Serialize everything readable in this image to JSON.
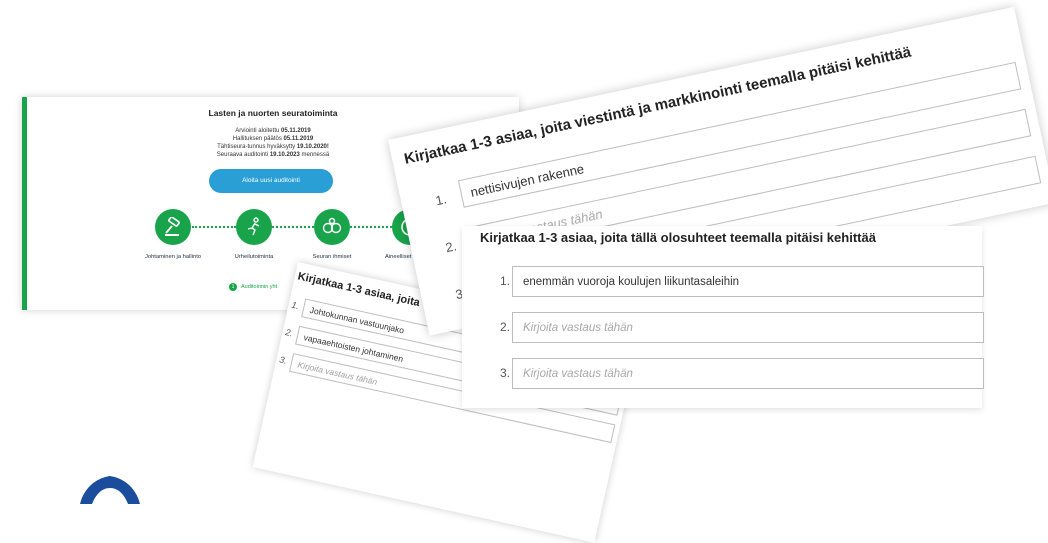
{
  "audit": {
    "title": "Lasten ja nuorten seuratoiminta",
    "lines": [
      {
        "label": "Arviointi aloitettu",
        "value": "05.11.2019"
      },
      {
        "label": "Hallituksen päätös",
        "value": "05.11.2019"
      },
      {
        "label": "Tähtiseura-tunnus hyväksytty",
        "value": "19.10.2020!"
      },
      {
        "label": "Seuraava auditointi",
        "value": "19.10.2023",
        "suffix": "mennessä"
      }
    ],
    "start_button": "Aloita uusi auditointi",
    "steps": [
      {
        "label": "Johtaminen ja hallinto",
        "icon": "gavel-icon"
      },
      {
        "label": "Urheilutoiminta",
        "icon": "runner-icon"
      },
      {
        "label": "Seuran ihmiset",
        "icon": "people-icon"
      },
      {
        "label": "Aineelliset resurssit",
        "icon": "resources-icon"
      }
    ],
    "progress_number": "1",
    "progress_text": "Auditoinnin yht"
  },
  "marketing": {
    "title": "Kirjatkaa 1-3 asiaa, joita viestintä ja markkinointi teemalla pitäisi kehittää",
    "rows": [
      {
        "num": "1.",
        "value": "nettisivujen rakenne",
        "placeholder": ""
      },
      {
        "num": "2.",
        "value": "",
        "placeholder": "Kirjoita vastaus tähän"
      },
      {
        "num": "3.",
        "value": "",
        "placeholder": ""
      }
    ]
  },
  "board": {
    "title": "Kirjatkaa 1-3 asiaa, joita",
    "rows": [
      {
        "num": "1.",
        "value": "Johtokunnan vastuunjako",
        "placeholder": ""
      },
      {
        "num": "2.",
        "value": "vapaaehtoisten johtaminen",
        "placeholder": ""
      },
      {
        "num": "3.",
        "value": "",
        "placeholder": "Kirjoita vastaus tähän"
      }
    ]
  },
  "conditions": {
    "title": "Kirjatkaa 1-3 asiaa, joita tällä olosuhteet teemalla pitäisi kehittää",
    "rows": [
      {
        "num": "1.",
        "value": "enemmän vuoroja koulujen liikuntasaleihin",
        "placeholder": ""
      },
      {
        "num": "2.",
        "value": "",
        "placeholder": "Kirjoita vastaus tähän"
      },
      {
        "num": "3.",
        "value": "",
        "placeholder": "Kirjoita vastaus tähän"
      }
    ]
  },
  "colors": {
    "accent_green": "#19a34a",
    "button_blue": "#2a9fd6",
    "logo_blue": "#1a4d9c"
  }
}
